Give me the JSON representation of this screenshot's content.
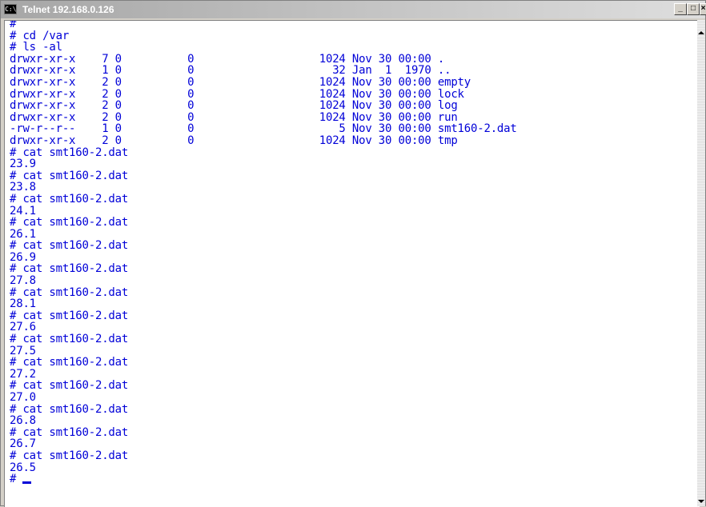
{
  "window": {
    "title": "Telnet 192.168.0.126",
    "app_icon": "console-icon",
    "app_icon_text": "C:\\",
    "buttons": {
      "minimize": "_",
      "maximize": "□",
      "close": "×"
    }
  },
  "terminal": {
    "text_color": "#0000d8",
    "lines": [
      "#",
      "# cd /var",
      "# ls -al",
      "drwxr-xr-x    7 0          0                   1024 Nov 30 00:00 .",
      "drwxr-xr-x    1 0          0                     32 Jan  1  1970 ..",
      "drwxr-xr-x    2 0          0                   1024 Nov 30 00:00 empty",
      "drwxr-xr-x    2 0          0                   1024 Nov 30 00:00 lock",
      "drwxr-xr-x    2 0          0                   1024 Nov 30 00:00 log",
      "drwxr-xr-x    2 0          0                   1024 Nov 30 00:00 run",
      "-rw-r--r--    1 0          0                      5 Nov 30 00:00 smt160-2.dat",
      "drwxr-xr-x    2 0          0                   1024 Nov 30 00:00 tmp",
      "# cat smt160-2.dat",
      "23.9",
      "# cat smt160-2.dat",
      "23.8",
      "# cat smt160-2.dat",
      "24.1",
      "# cat smt160-2.dat",
      "26.1",
      "# cat smt160-2.dat",
      "26.9",
      "# cat smt160-2.dat",
      "27.8",
      "# cat smt160-2.dat",
      "28.1",
      "# cat smt160-2.dat",
      "27.6",
      "# cat smt160-2.dat",
      "27.5",
      "# cat smt160-2.dat",
      "27.2",
      "# cat smt160-2.dat",
      "27.0",
      "# cat smt160-2.dat",
      "26.8",
      "# cat smt160-2.dat",
      "26.7",
      "# cat smt160-2.dat",
      "26.5"
    ],
    "prompt": "# "
  }
}
